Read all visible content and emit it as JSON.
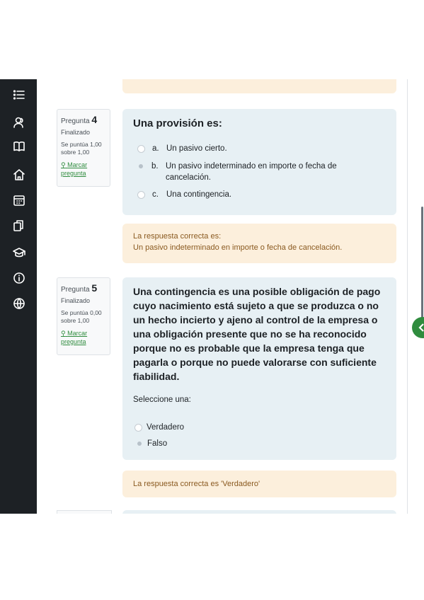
{
  "nav": {
    "icons": [
      "list-icon",
      "participants-icon",
      "book-icon",
      "home-icon",
      "calendar-icon",
      "files-icon",
      "graduation-cap-icon",
      "info-icon",
      "globe-icon"
    ]
  },
  "q4": {
    "label": "Pregunta",
    "number": "4",
    "state": "Finalizado",
    "grade": "Se puntúa 1,00 sobre 1,00",
    "flag": "Marcar pregunta",
    "text": "Una provisión es:",
    "options": [
      {
        "letter": "a.",
        "text": "Un pasivo cierto.",
        "selected": false
      },
      {
        "letter": "b.",
        "text": "Un pasivo indeterminado en importe o fecha de cancelación.",
        "selected": true
      },
      {
        "letter": "c.",
        "text": "Una contingencia.",
        "selected": false
      }
    ],
    "feedback_intro": "La respuesta correcta es:",
    "feedback_answer": "Un pasivo indeterminado en importe o fecha de cancelación."
  },
  "q5": {
    "label": "Pregunta",
    "number": "5",
    "state": "Finalizado",
    "grade": "Se puntúa 0,00 sobre 1,00",
    "flag": "Marcar pregunta",
    "text": "Una contingencia es una posible obligación de pago cuyo nacimiento está sujeto a que se produzca o no un hecho incierto y ajeno al control de la empresa o una obligación presente que no se ha reconocido porque no es probable que la empresa tenga que pagarla o porque no puede valorarse con suficiente fiabilidad.",
    "prompt": "Seleccione una:",
    "options": [
      {
        "text": "Verdadero",
        "selected": false
      },
      {
        "text": "Falso",
        "selected": true
      }
    ],
    "feedback": "La respuesta correcta es 'Verdadero'"
  },
  "colors": {
    "sidebar": "#1d2125",
    "question_bg": "#e7f0f4",
    "feedback_bg": "#fcefdc",
    "accent": "#2f8c3e"
  }
}
